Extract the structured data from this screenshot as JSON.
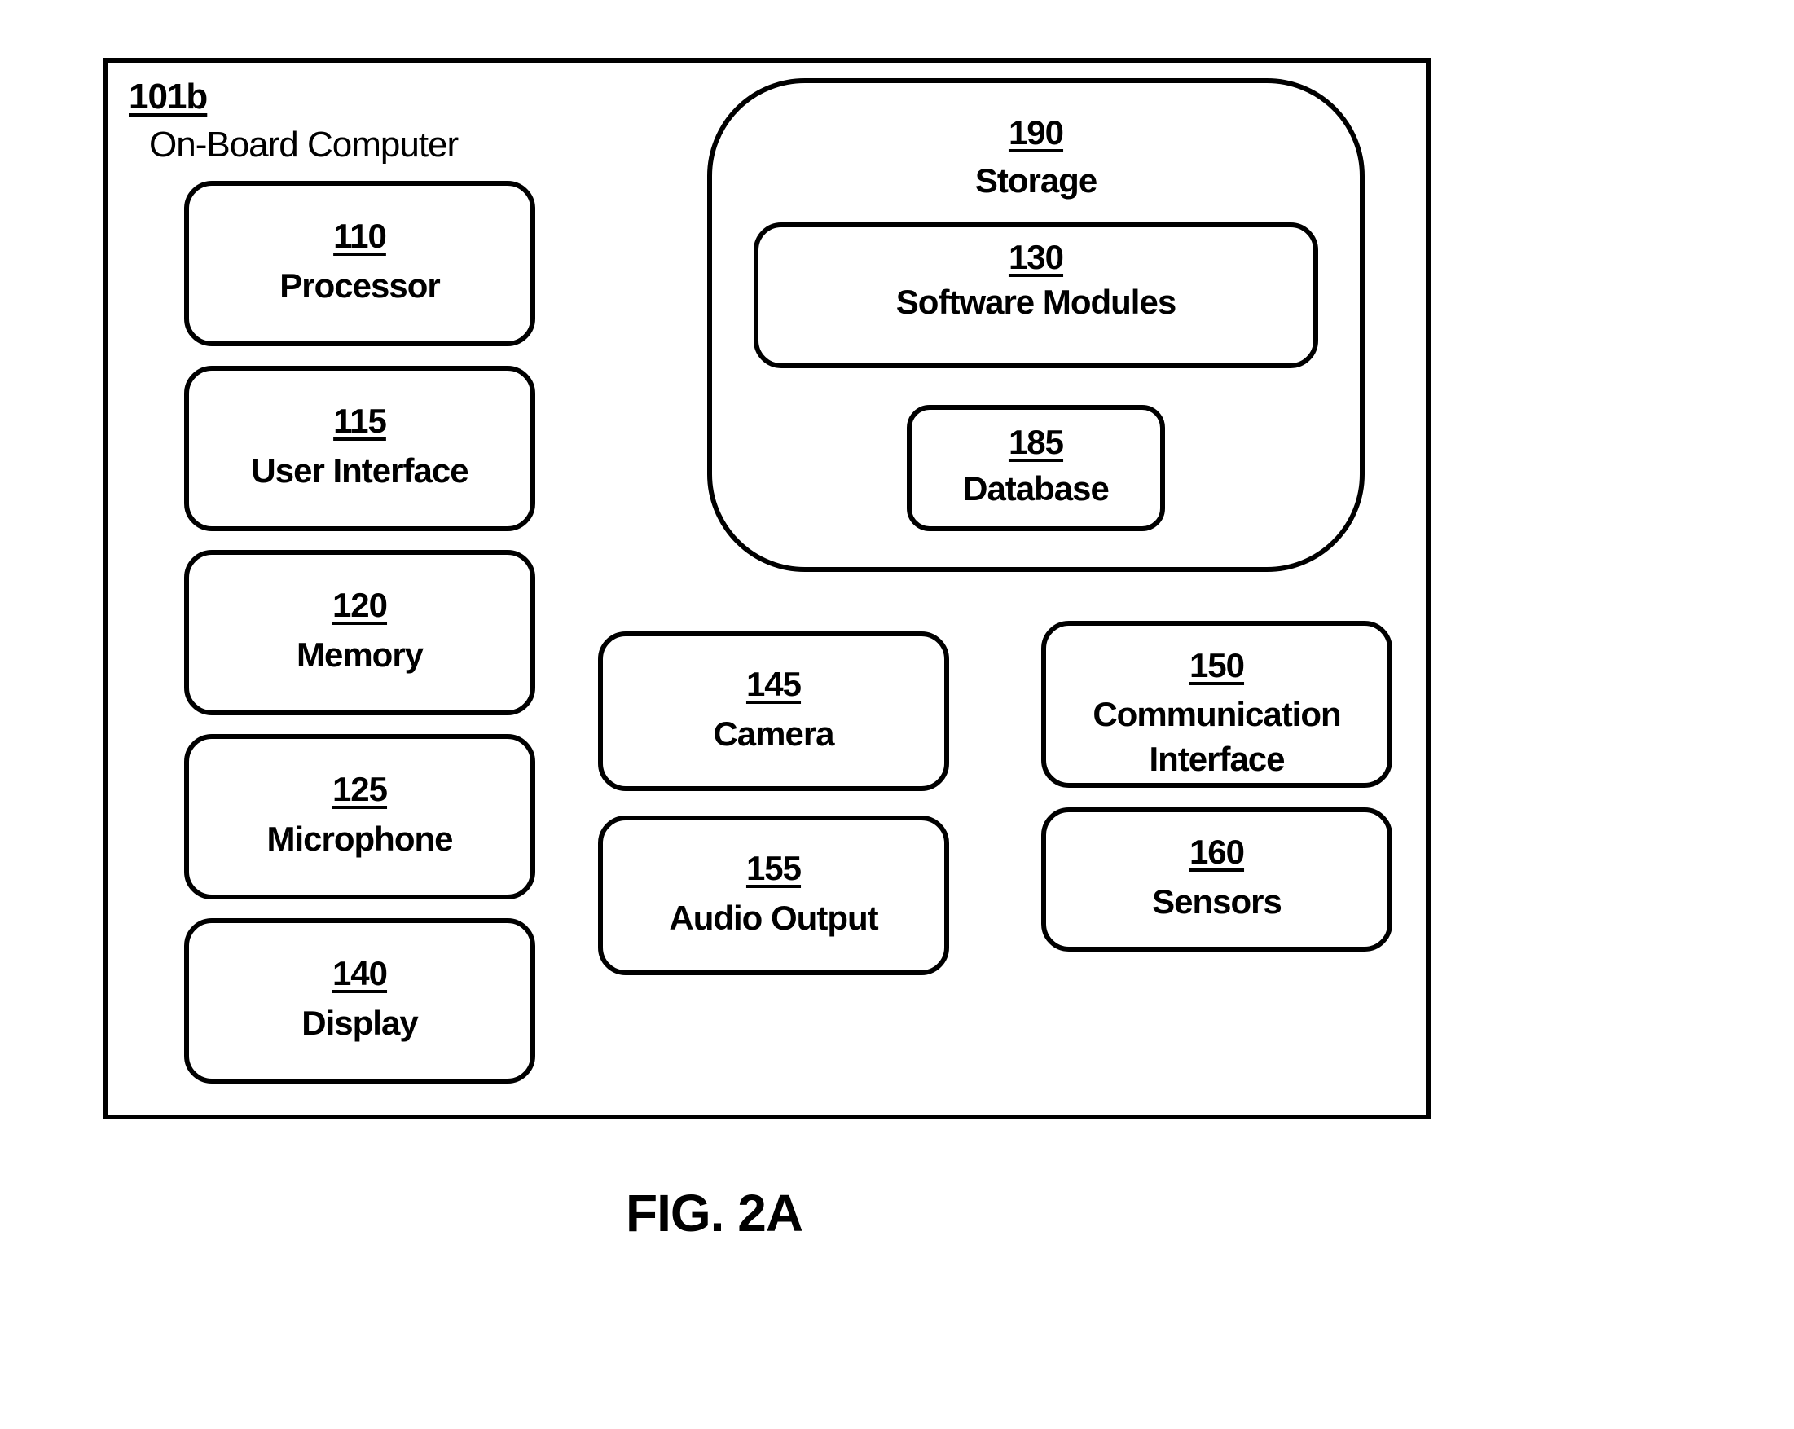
{
  "figure": {
    "caption": "FIG. 2A",
    "container": {
      "ref": "101b",
      "name": "On-Board Computer"
    },
    "left_column": [
      {
        "ref": "110",
        "label": "Processor"
      },
      {
        "ref": "115",
        "label": "User Interface"
      },
      {
        "ref": "120",
        "label": "Memory"
      },
      {
        "ref": "125",
        "label": "Microphone"
      },
      {
        "ref": "140",
        "label": "Display"
      }
    ],
    "storage": {
      "ref": "190",
      "label": "Storage",
      "software_modules": {
        "ref": "130",
        "label": "Software Modules"
      },
      "database": {
        "ref": "185",
        "label": "Database"
      }
    },
    "middle_column": [
      {
        "ref": "145",
        "label": "Camera"
      },
      {
        "ref": "155",
        "label": "Audio Output"
      }
    ],
    "right_column": [
      {
        "ref": "150",
        "label_line1": "Communication",
        "label_line2": "Interface"
      },
      {
        "ref": "160",
        "label": "Sensors"
      }
    ]
  }
}
